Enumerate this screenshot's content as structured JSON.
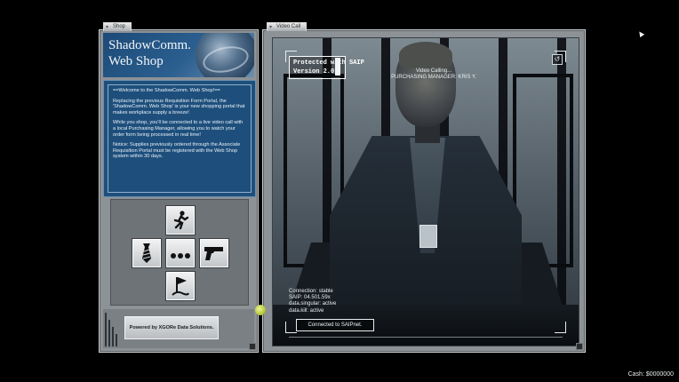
{
  "shop": {
    "tab_label": "Shop",
    "title": "ShadowComm.\nWeb Shop",
    "welcome": {
      "heading": "==Welcome to the ShadowComm. Web Shop!==",
      "para1": "Replacing the previous Requisition Form Portal, the 'ShadowComm. Web Shop' is your new shopping portal that makes workplace supply a breeze!",
      "para2": "While you shop, you'll be connected to a live video call with a local Purchasing Manager, allowing you to watch your order form being processed in real time!",
      "para3": "Notice: Supplies previously ordered through the Associate Requisition Portal must be registered with the Web Shop system within 30 days."
    },
    "buttons": {
      "up_icon": "running-figure-icon",
      "left_icon": "necktie-icon",
      "center_icon": "ellipsis-icon",
      "right_icon": "pistol-icon",
      "down_icon": "flag-icon"
    },
    "footer_label": "Powered by XGORe Data Solutions."
  },
  "video": {
    "tab_label": "Video Call",
    "protected_line1": "Protected with SAIP",
    "protected_line2": "Version 2.0",
    "calling_line1": "Video Calling...",
    "calling_line2": "PURCHASING MANAGER: KRIS Y.",
    "status": {
      "line1": "Connection: stable",
      "line2": "SAIP: 04.501.59x",
      "line3": "data.singular: active",
      "line4": "data.kill: active"
    },
    "connected_label": "Connected to SAIPnet.",
    "return_icon": "return-arrow-icon"
  },
  "cash": "Cash: $0000000",
  "colors": {
    "shop_header_blue": "#1c4a78",
    "welcome_blue": "#1e4f7c",
    "window_gray": "#8d9296"
  }
}
